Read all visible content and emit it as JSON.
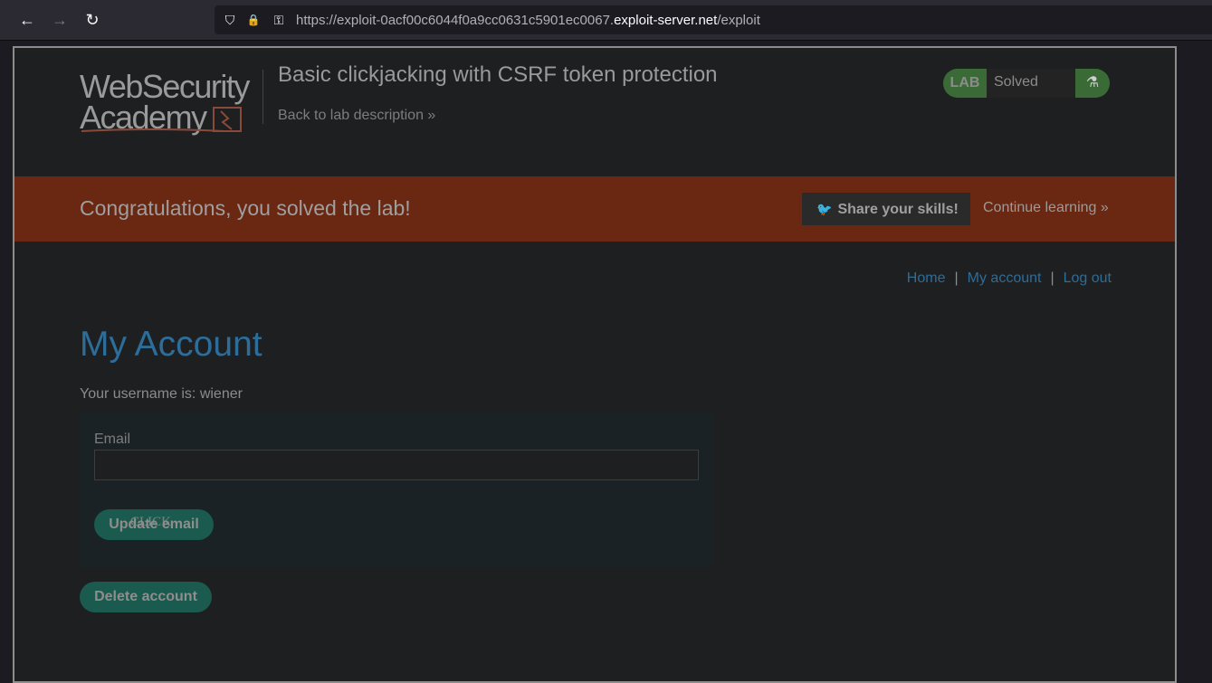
{
  "browser": {
    "back_icon": "←",
    "forward_icon": "→",
    "reload_icon": "↻",
    "shield_icon": "⛉",
    "lock_icon": "🔒",
    "key_icon": "⚿",
    "url_prefix": "https://exploit-0acf00c6044f0a9cc0631c5901ec0067.",
    "url_host": "exploit-server.net",
    "url_path": "/exploit"
  },
  "header": {
    "logo_line1": "WebSecurity",
    "logo_line2": "Academy",
    "lab_title": "Basic clickjacking with CSRF token protection",
    "back_link": "Back to lab description »",
    "status_label": "LAB",
    "status_value": "Solved",
    "status_icon": "⚗"
  },
  "banner": {
    "message": "Congratulations, you solved the lab!",
    "share_label": "Share your skills!",
    "share_icon": "🐦",
    "continue_label": "Continue learning »"
  },
  "nav": {
    "home": "Home",
    "my_account": "My account",
    "log_out": "Log out",
    "separator": "|"
  },
  "account": {
    "heading": "My Account",
    "username_line": "Your username is: wiener",
    "email_label": "Email",
    "email_value": "",
    "update_label": "Update email",
    "decoy_label": "CLICK",
    "delete_label": "Delete account"
  },
  "colors": {
    "accent_link": "#2d6d99",
    "banner_bg": "#6a2712",
    "button_bg": "#1b5a4e",
    "status_green": "#3a6a36"
  }
}
